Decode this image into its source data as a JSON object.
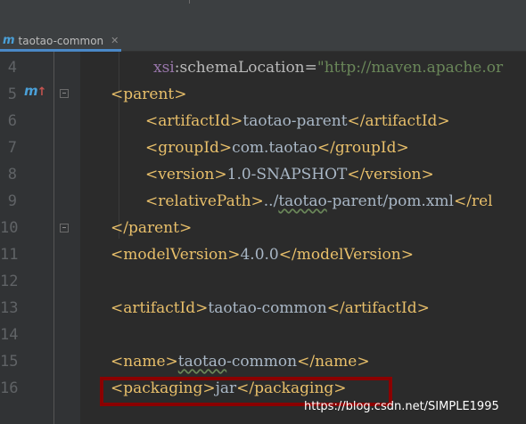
{
  "tab": {
    "icon": "maven-m-icon",
    "label": "taotao-common",
    "close_icon": "close-icon"
  },
  "lines": [
    {
      "num": "4"
    },
    {
      "num": "5"
    },
    {
      "num": "6"
    },
    {
      "num": "7"
    },
    {
      "num": "8"
    },
    {
      "num": "9"
    },
    {
      "num": "10"
    },
    {
      "num": "11"
    },
    {
      "num": "12"
    },
    {
      "num": "13"
    },
    {
      "num": "14"
    },
    {
      "num": "15"
    },
    {
      "num": "16"
    }
  ],
  "code": {
    "l4": {
      "ns": "xsi",
      "colon": ":",
      "attr": "schemaLocation",
      "eq": "=",
      "val": "\"http://maven.apache.or"
    },
    "l5": {
      "open": "<parent>"
    },
    "l6": {
      "open": "<artifactId>",
      "text": "taotao-parent",
      "close": "</artifactId>"
    },
    "l7": {
      "open": "<groupId>",
      "text": "com.taotao",
      "close": "</groupId>"
    },
    "l8": {
      "open": "<version>",
      "text": "1.0-SNAPSHOT",
      "close": "</version>"
    },
    "l9": {
      "open": "<relativePath>",
      "text1": "../",
      "text2": "taotao",
      "text3": "-parent/pom.xml",
      "close": "</rel"
    },
    "l10": {
      "close": "</parent>"
    },
    "l11": {
      "open": "<modelVersion>",
      "text": "4.0.0",
      "close": "</modelVersion>"
    },
    "l13": {
      "open": "<artifactId>",
      "text": "taotao-common",
      "close": "</artifactId>"
    },
    "l15": {
      "open": "<name>",
      "text1": "taotao",
      "text2": "-common",
      "close": "</name>"
    },
    "l16": {
      "open": "<packaging>",
      "text": "jar",
      "close": "</packaging>"
    }
  },
  "colors": {
    "highlight": "#8b0000",
    "tab_underline": "#4a88c7",
    "maven_icon": "#4aa0d8"
  },
  "watermark": "https://blog.csdn.net/SIMPLE1995"
}
